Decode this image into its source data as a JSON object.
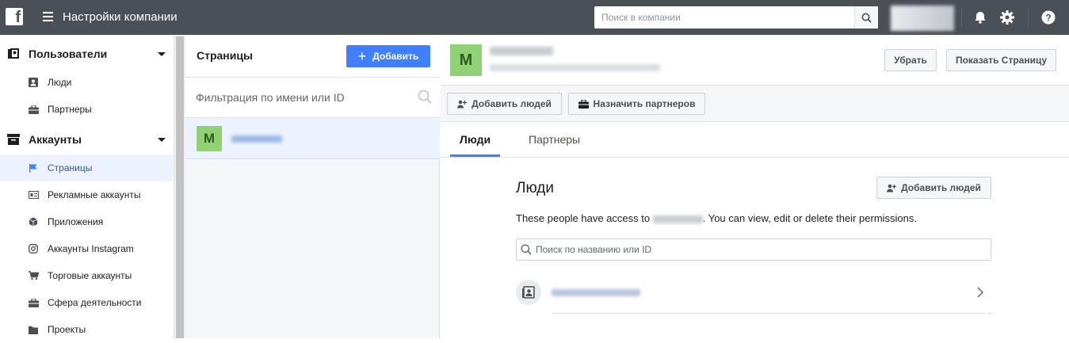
{
  "topbar": {
    "logo": "f",
    "title": "Настройки компании",
    "search_placeholder": "Поиск в компании"
  },
  "sidebar": {
    "sections": [
      {
        "label": "Пользователи",
        "icon": "users-icon"
      },
      {
        "label": "Аккаунты",
        "icon": "accounts-icon"
      }
    ],
    "users_items": [
      {
        "label": "Люди",
        "icon": "person-icon"
      },
      {
        "label": "Партнеры",
        "icon": "briefcase-icon"
      }
    ],
    "accounts_items": [
      {
        "label": "Страницы",
        "icon": "flag-icon",
        "active": true
      },
      {
        "label": "Рекламные аккаунты",
        "icon": "ad-account-icon"
      },
      {
        "label": "Приложения",
        "icon": "cube-icon"
      },
      {
        "label": "Аккаунты Instagram",
        "icon": "instagram-icon"
      },
      {
        "label": "Торговые аккаунты",
        "icon": "cart-icon"
      },
      {
        "label": "Сфера деятельности",
        "icon": "briefcase-icon"
      },
      {
        "label": "Проекты",
        "icon": "folder-icon"
      }
    ]
  },
  "pages_panel": {
    "title": "Страницы",
    "add_label": "Добавить",
    "filter_placeholder": "Фильтрация по имени или ID",
    "page_avatar_letter": "M"
  },
  "detail": {
    "avatar_letter": "M",
    "remove_label": "Убрать",
    "show_page_label": "Показать Страницу",
    "add_people_label": "Добавить людей",
    "assign_partners_label": "Назначить партнеров",
    "tabs": [
      {
        "label": "Люди",
        "active": true
      },
      {
        "label": "Партнеры",
        "active": false
      }
    ],
    "section_title": "Люди",
    "section_add_label": "Добавить людей",
    "desc_prefix": "These people have access to",
    "desc_suffix": ". You can view, edit or delete their permissions.",
    "people_search_placeholder": "Поиск по названию или ID"
  },
  "colors": {
    "topbar": "#4b4f56",
    "accent": "#4080ff",
    "avatar_green": "#8fd174",
    "active_bg": "#ecf3ff"
  }
}
